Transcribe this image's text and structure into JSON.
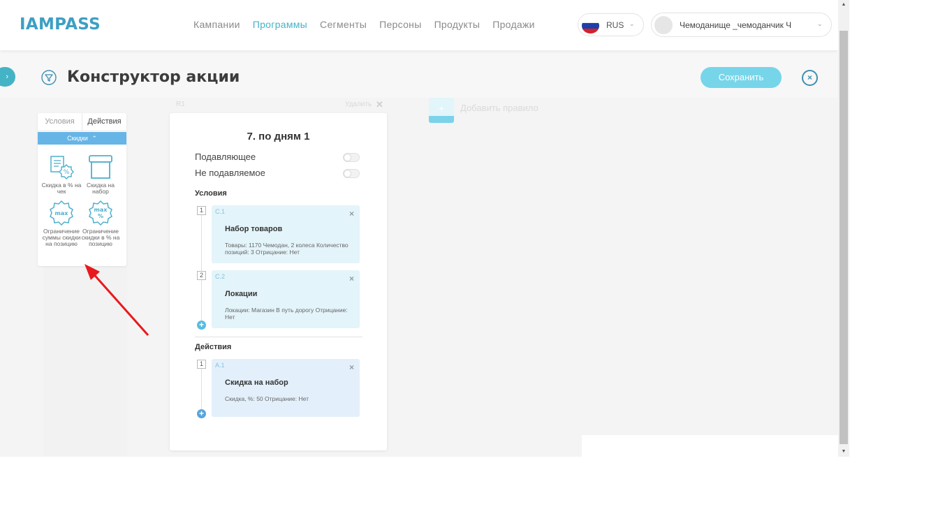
{
  "header": {
    "logo": "IAMPASS",
    "nav": [
      "Кампании",
      "Программы",
      "Сегменты",
      "Персоны",
      "Продукты",
      "Продажи"
    ],
    "active_nav": "Программы",
    "language": "RUS",
    "user_name": "Чемоданище _чемоданчик Ч"
  },
  "page": {
    "title": "Конструктор акции",
    "save_label": "Сохранить",
    "sidebar_toggle": "›",
    "close_glyph": "×"
  },
  "palette": {
    "tabs": [
      "Условия",
      "Действия"
    ],
    "active_tab": "Действия",
    "category": "Скидки",
    "category_chevron": "⌃",
    "items": [
      {
        "label": "Скидка в % на чек",
        "icon": "receipt-percent-icon"
      },
      {
        "label": "Скидка на набор",
        "icon": "box-icon"
      },
      {
        "label": "Ограничение суммы скидки на позицию",
        "icon": "max-badge-icon"
      },
      {
        "label": "Ограничение скидки в % на позицию",
        "icon": "max-percent-badge-icon"
      }
    ]
  },
  "ghost": {
    "rule_label": "R1",
    "delete_label": "Удалить",
    "delete_glyph": "✕"
  },
  "rule": {
    "title": "7. по дням 1",
    "toggles": [
      {
        "label": "Подавляющее",
        "on": false
      },
      {
        "label": "Не подавляемое",
        "on": false
      }
    ],
    "conditions_label": "Условия",
    "conditions": [
      {
        "num": "1",
        "id": "C.1",
        "title": "Набор товаров",
        "desc": "Товары: 1170 Чемодан, 2 колеса Количество позиций: 3 Отрицание: Нет"
      },
      {
        "num": "2",
        "id": "C.2",
        "title": "Локации",
        "desc": "Локации: Магазин В путь дорогу Отрицание: Нет"
      }
    ],
    "actions_label": "Действия",
    "actions": [
      {
        "num": "1",
        "id": "A.1",
        "title": "Скидка на набор",
        "desc": "Скидка, %: 50 Отрицание: Нет"
      }
    ],
    "remove_glyph": "×",
    "add_glyph": "+"
  },
  "add_rule": {
    "glyph": "+",
    "label": "Добавить правило"
  },
  "colors": {
    "brand": "#3e9fc4",
    "accent": "#44b3c6",
    "save_button": "#77d5ea",
    "category_bar": "#66b5e6",
    "condition_block": "#e3f4fa",
    "action_block": "#e3f0fb",
    "annotation_arrow": "#e8191c"
  }
}
